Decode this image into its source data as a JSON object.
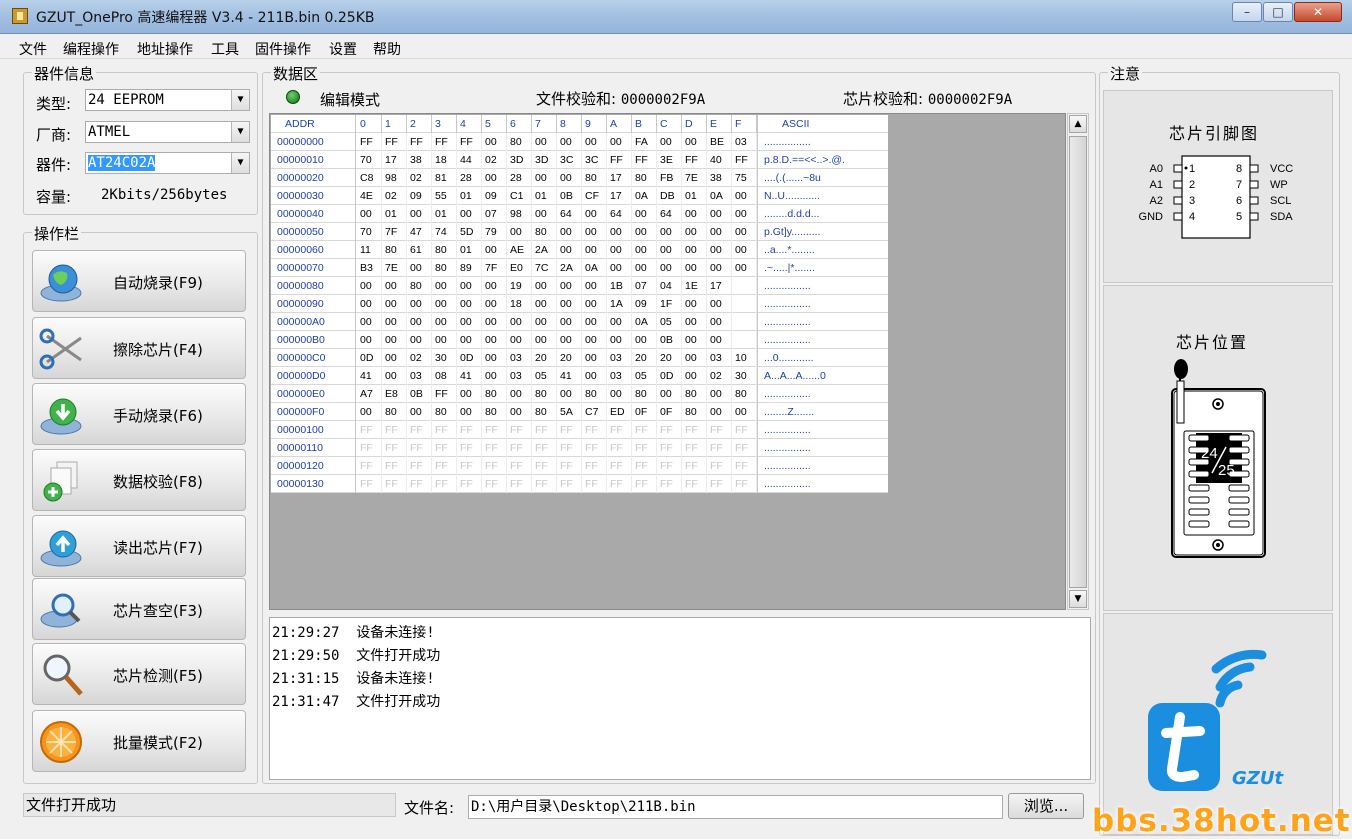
{
  "window": {
    "title": "GZUT_OnePro 高速编程器 V3.4 - 211B.bin  0.25KB",
    "minimize_label": "–",
    "maximize_label": "□",
    "close_label": "✕"
  },
  "menu": [
    "文件",
    "编程操作",
    "地址操作",
    "工具",
    "固件操作",
    "设置",
    "帮助"
  ],
  "device_info": {
    "title": "器件信息",
    "type_label": "类型:",
    "type_value": "24 EEPROM",
    "vendor_label": "厂商:",
    "vendor_value": "ATMEL",
    "device_label": "器件:",
    "device_value": "AT24C02A",
    "capacity_label": "容量:",
    "capacity_value": "2Kbits/256bytes"
  },
  "operations": {
    "title": "操作栏",
    "buttons": [
      {
        "label": "自动烧录(F9)",
        "icon": "globe-disc-icon"
      },
      {
        "label": "擦除芯片(F4)",
        "icon": "scissors-icon"
      },
      {
        "label": "手动烧录(F6)",
        "icon": "download-disc-icon"
      },
      {
        "label": "数据校验(F8)",
        "icon": "add-document-icon"
      },
      {
        "label": "读出芯片(F7)",
        "icon": "upload-disc-icon"
      },
      {
        "label": "芯片查空(F3)",
        "icon": "magnifier-disc-icon"
      },
      {
        "label": "芯片检测(F5)",
        "icon": "magnifying-glass-icon"
      },
      {
        "label": "批量模式(F2)",
        "icon": "orange-slice-icon"
      }
    ]
  },
  "data_area": {
    "title": "数据区",
    "mode_label": "编辑模式",
    "file_checksum_label": "文件校验和:",
    "file_checksum_value": "0000002F9A",
    "chip_checksum_label": "芯片校验和:",
    "chip_checksum_value": "0000002F9A",
    "header": {
      "addr": "ADDR",
      "cols": [
        "0",
        "1",
        "2",
        "3",
        "4",
        "5",
        "6",
        "7",
        "8",
        "9",
        "A",
        "B",
        "C",
        "D",
        "E",
        "F"
      ],
      "ascii": "ASCII"
    },
    "rows": [
      {
        "addr": "00000000",
        "bytes": [
          "FF",
          "FF",
          "FF",
          "FF",
          "FF",
          "00",
          "80",
          "00",
          "00",
          "00",
          "00",
          "FA",
          "00",
          "00",
          "BE",
          "03"
        ],
        "ascii": "................"
      },
      {
        "addr": "00000010",
        "bytes": [
          "70",
          "17",
          "38",
          "18",
          "44",
          "02",
          "3D",
          "3D",
          "3C",
          "3C",
          "FF",
          "FF",
          "3E",
          "FF",
          "40",
          "FF"
        ],
        "ascii": "p.8.D.==<<..>.@."
      },
      {
        "addr": "00000020",
        "bytes": [
          "C8",
          "98",
          "02",
          "81",
          "28",
          "00",
          "28",
          "00",
          "00",
          "80",
          "17",
          "80",
          "FB",
          "7E",
          "38",
          "75"
        ],
        "ascii": "....(.(......~8u"
      },
      {
        "addr": "00000030",
        "bytes": [
          "4E",
          "02",
          "09",
          "55",
          "01",
          "09",
          "C1",
          "01",
          "0B",
          "CF",
          "17",
          "0A",
          "DB",
          "01",
          "0A",
          "00"
        ],
        "ascii": "N..U............"
      },
      {
        "addr": "00000040",
        "bytes": [
          "00",
          "01",
          "00",
          "01",
          "00",
          "07",
          "98",
          "00",
          "64",
          "00",
          "64",
          "00",
          "64",
          "00",
          "00",
          "00"
        ],
        "ascii": "........d.d.d..."
      },
      {
        "addr": "00000050",
        "bytes": [
          "70",
          "7F",
          "47",
          "74",
          "5D",
          "79",
          "00",
          "80",
          "00",
          "00",
          "00",
          "00",
          "00",
          "00",
          "00",
          "00"
        ],
        "ascii": "p.Gt]y.........."
      },
      {
        "addr": "00000060",
        "bytes": [
          "11",
          "80",
          "61",
          "80",
          "01",
          "00",
          "AE",
          "2A",
          "00",
          "00",
          "00",
          "00",
          "00",
          "00",
          "00",
          "00"
        ],
        "ascii": "..a....*........"
      },
      {
        "addr": "00000070",
        "bytes": [
          "B3",
          "7E",
          "00",
          "80",
          "89",
          "7F",
          "E0",
          "7C",
          "2A",
          "0A",
          "00",
          "00",
          "00",
          "00",
          "00",
          "00"
        ],
        "ascii": ".~.....|*......."
      },
      {
        "addr": "00000080",
        "bytes": [
          "00",
          "00",
          "80",
          "00",
          "00",
          "00",
          "19",
          "00",
          "00",
          "00",
          "1B",
          "07",
          "04",
          "1E",
          "17",
          ""
        ],
        "ascii": "................"
      },
      {
        "addr": "00000090",
        "bytes": [
          "00",
          "00",
          "00",
          "00",
          "00",
          "00",
          "18",
          "00",
          "00",
          "00",
          "1A",
          "09",
          "1F",
          "00",
          "00",
          ""
        ],
        "ascii": "................"
      },
      {
        "addr": "000000A0",
        "bytes": [
          "00",
          "00",
          "00",
          "00",
          "00",
          "00",
          "00",
          "00",
          "00",
          "00",
          "00",
          "0A",
          "05",
          "00",
          "00",
          ""
        ],
        "ascii": "................"
      },
      {
        "addr": "000000B0",
        "bytes": [
          "00",
          "00",
          "00",
          "00",
          "00",
          "00",
          "00",
          "00",
          "00",
          "00",
          "00",
          "00",
          "0B",
          "00",
          "00",
          ""
        ],
        "ascii": "................"
      },
      {
        "addr": "000000C0",
        "bytes": [
          "0D",
          "00",
          "02",
          "30",
          "0D",
          "00",
          "03",
          "20",
          "20",
          "00",
          "03",
          "20",
          "20",
          "00",
          "03",
          "10"
        ],
        "ascii": "...0............"
      },
      {
        "addr": "000000D0",
        "bytes": [
          "41",
          "00",
          "03",
          "08",
          "41",
          "00",
          "03",
          "05",
          "41",
          "00",
          "03",
          "05",
          "0D",
          "00",
          "02",
          "30"
        ],
        "ascii": "A...A...A......0"
      },
      {
        "addr": "000000E0",
        "bytes": [
          "A7",
          "E8",
          "0B",
          "FF",
          "00",
          "80",
          "00",
          "80",
          "00",
          "80",
          "00",
          "80",
          "00",
          "80",
          "00",
          "80"
        ],
        "ascii": "................"
      },
      {
        "addr": "000000F0",
        "bytes": [
          "00",
          "80",
          "00",
          "80",
          "00",
          "80",
          "00",
          "80",
          "5A",
          "C7",
          "ED",
          "0F",
          "0F",
          "80",
          "00",
          "00"
        ],
        "ascii": "........Z......."
      },
      {
        "addr": "00000100",
        "bytes": [
          "FF",
          "FF",
          "FF",
          "FF",
          "FF",
          "FF",
          "FF",
          "FF",
          "FF",
          "FF",
          "FF",
          "FF",
          "FF",
          "FF",
          "FF",
          "FF"
        ],
        "ascii": "................",
        "dim": true
      },
      {
        "addr": "00000110",
        "bytes": [
          "FF",
          "FF",
          "FF",
          "FF",
          "FF",
          "FF",
          "FF",
          "FF",
          "FF",
          "FF",
          "FF",
          "FF",
          "FF",
          "FF",
          "FF",
          "FF"
        ],
        "ascii": "................",
        "dim": true
      },
      {
        "addr": "00000120",
        "bytes": [
          "FF",
          "FF",
          "FF",
          "FF",
          "FF",
          "FF",
          "FF",
          "FF",
          "FF",
          "FF",
          "FF",
          "FF",
          "FF",
          "FF",
          "FF",
          "FF"
        ],
        "ascii": "................",
        "dim": true
      },
      {
        "addr": "00000130",
        "bytes": [
          "FF",
          "FF",
          "FF",
          "FF",
          "FF",
          "FF",
          "FF",
          "FF",
          "FF",
          "FF",
          "FF",
          "FF",
          "FF",
          "FF",
          "FF",
          "FF"
        ],
        "ascii": "................",
        "dim": true
      }
    ]
  },
  "log": [
    {
      "time": "21:29:27",
      "msg": "设备未连接!"
    },
    {
      "time": "21:29:50",
      "msg": "文件打开成功"
    },
    {
      "time": "21:31:15",
      "msg": "设备未连接!"
    },
    {
      "time": "21:31:47",
      "msg": "文件打开成功"
    }
  ],
  "notes": {
    "title": "注意",
    "pin_diagram_title": "芯片引脚图",
    "pins_left": [
      {
        "name": "A0",
        "num": "1"
      },
      {
        "name": "A1",
        "num": "2"
      },
      {
        "name": "A2",
        "num": "3"
      },
      {
        "name": "GND",
        "num": "4"
      }
    ],
    "pins_right": [
      {
        "name": "VCC",
        "num": "8"
      },
      {
        "name": "WP",
        "num": "7"
      },
      {
        "name": "SCL",
        "num": "6"
      },
      {
        "name": "SDA",
        "num": "5"
      }
    ],
    "chip_position_title": "芯片位置",
    "chip_label_top": "24",
    "chip_label_bottom": "25",
    "brand": "GZUt"
  },
  "statusbar": {
    "status_text": "文件打开成功",
    "filename_label": "文件名:",
    "filename_value": "D:\\用户目录\\Desktop\\211B.bin",
    "browse_label": "浏览..."
  },
  "watermark": "bbs.38hot.net",
  "colors": {
    "hex_address": "#1f3fa8",
    "selection": "#3399ff",
    "brand_blue": "#1c8ee0",
    "watermark": "#ffa31a",
    "led_green": "#1f9e24"
  }
}
